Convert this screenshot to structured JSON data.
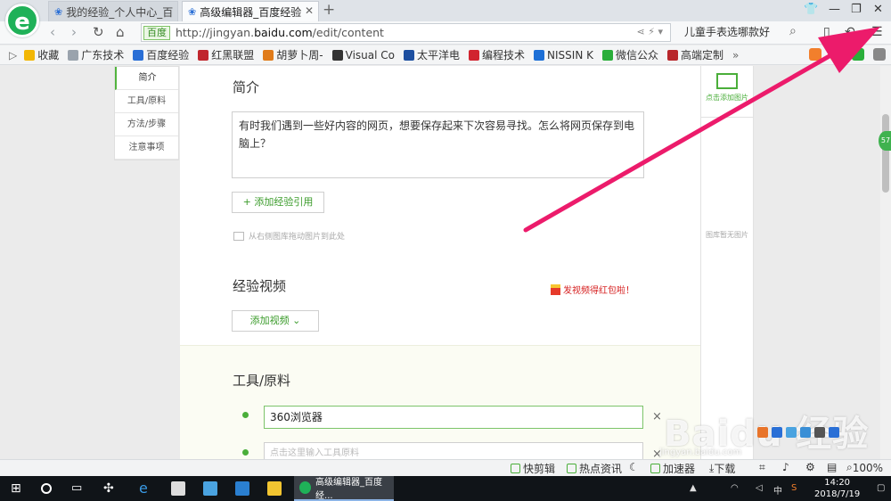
{
  "browser": {
    "logo_letter": "e",
    "tabs": [
      {
        "label": "我的经验_个人中心_百",
        "active": false
      },
      {
        "label": "高级编辑器_百度经验",
        "active": true
      }
    ],
    "new_tab": "+",
    "url_badge": "百度",
    "url_prefix": "http://jingyan.",
    "url_domain": "baidu.com",
    "url_path": "/edit/content",
    "search_suggestion": "儿童手表选哪款好",
    "bookmarks": [
      {
        "label": "收藏",
        "color": "#f2b705"
      },
      {
        "label": "广东技术",
        "color": "#9aa3ad"
      },
      {
        "label": "百度经验",
        "color": "#2a6fd6"
      },
      {
        "label": "红黑联盟",
        "color": "#c0262d"
      },
      {
        "label": "胡萝卜周-",
        "color": "#e07b1a"
      },
      {
        "label": "Visual Co",
        "color": "#333333"
      },
      {
        "label": "太平洋电",
        "color": "#1d4fa0"
      },
      {
        "label": "编程技术",
        "color": "#d1242f"
      },
      {
        "label": "NISSIN K",
        "color": "#1d6fd6"
      },
      {
        "label": "微信公众",
        "color": "#2aae3a"
      },
      {
        "label": "高端定制",
        "color": "#b8262b"
      }
    ],
    "bookmarks_more": "»"
  },
  "sidenav": {
    "items": [
      "简介",
      "工具/原料",
      "方法/步骤",
      "注意事项"
    ]
  },
  "editor": {
    "intro_title": "简介",
    "intro_text": "有时我们遇到一些好内容的网页，想要保存起来下次容易寻找。怎么将网页保存到电脑上？",
    "add_reference": "+ 添加经验引用",
    "drag_hint": "从右侧图库拖动图片到此处",
    "video_title": "经验视频",
    "video_promo": "发视频得红包啦！",
    "add_video": "添加视频 ⌄",
    "tools_title": "工具/原料",
    "tool_value": "360浏览器",
    "tool_placeholder": "点击这里输入工具原料",
    "remove": "×"
  },
  "right_panel": {
    "add_image": "点击添加图片",
    "empty": "图库暂无图片"
  },
  "float_badge": "57",
  "watermark": {
    "text": "Baidu 经验",
    "sub": "jingyan.baidu.com"
  },
  "statusbar": {
    "quick_edit": "快剪辑",
    "hot_news": "热点资讯",
    "accelerator": "加速器",
    "download": "下载",
    "zoom": "100%"
  },
  "taskbar": {
    "active_window": "高级编辑器_百度经...",
    "ime": "中",
    "time": "14:20",
    "date": "2018/7/19"
  },
  "colors": {
    "accent_green": "#4aae3a",
    "arrow": "#ec1b6b"
  }
}
